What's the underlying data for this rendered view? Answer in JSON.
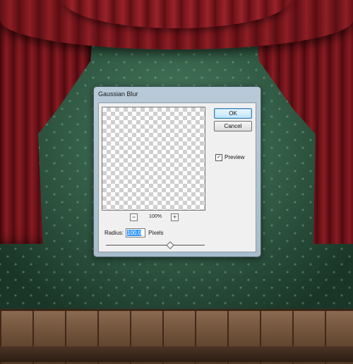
{
  "dialog": {
    "title": "Gaussian Blur",
    "ok_label": "OK",
    "cancel_label": "Cancel",
    "preview_label": "Preview",
    "preview_checked": true,
    "preview_check_glyph": "✓",
    "zoom_level": "100%",
    "zoom_out_glyph": "−",
    "zoom_in_glyph": "+",
    "radius_label": "Radius:",
    "radius_value": "100.0",
    "radius_unit": "Pixels",
    "radius_slider_fraction": 0.64
  }
}
